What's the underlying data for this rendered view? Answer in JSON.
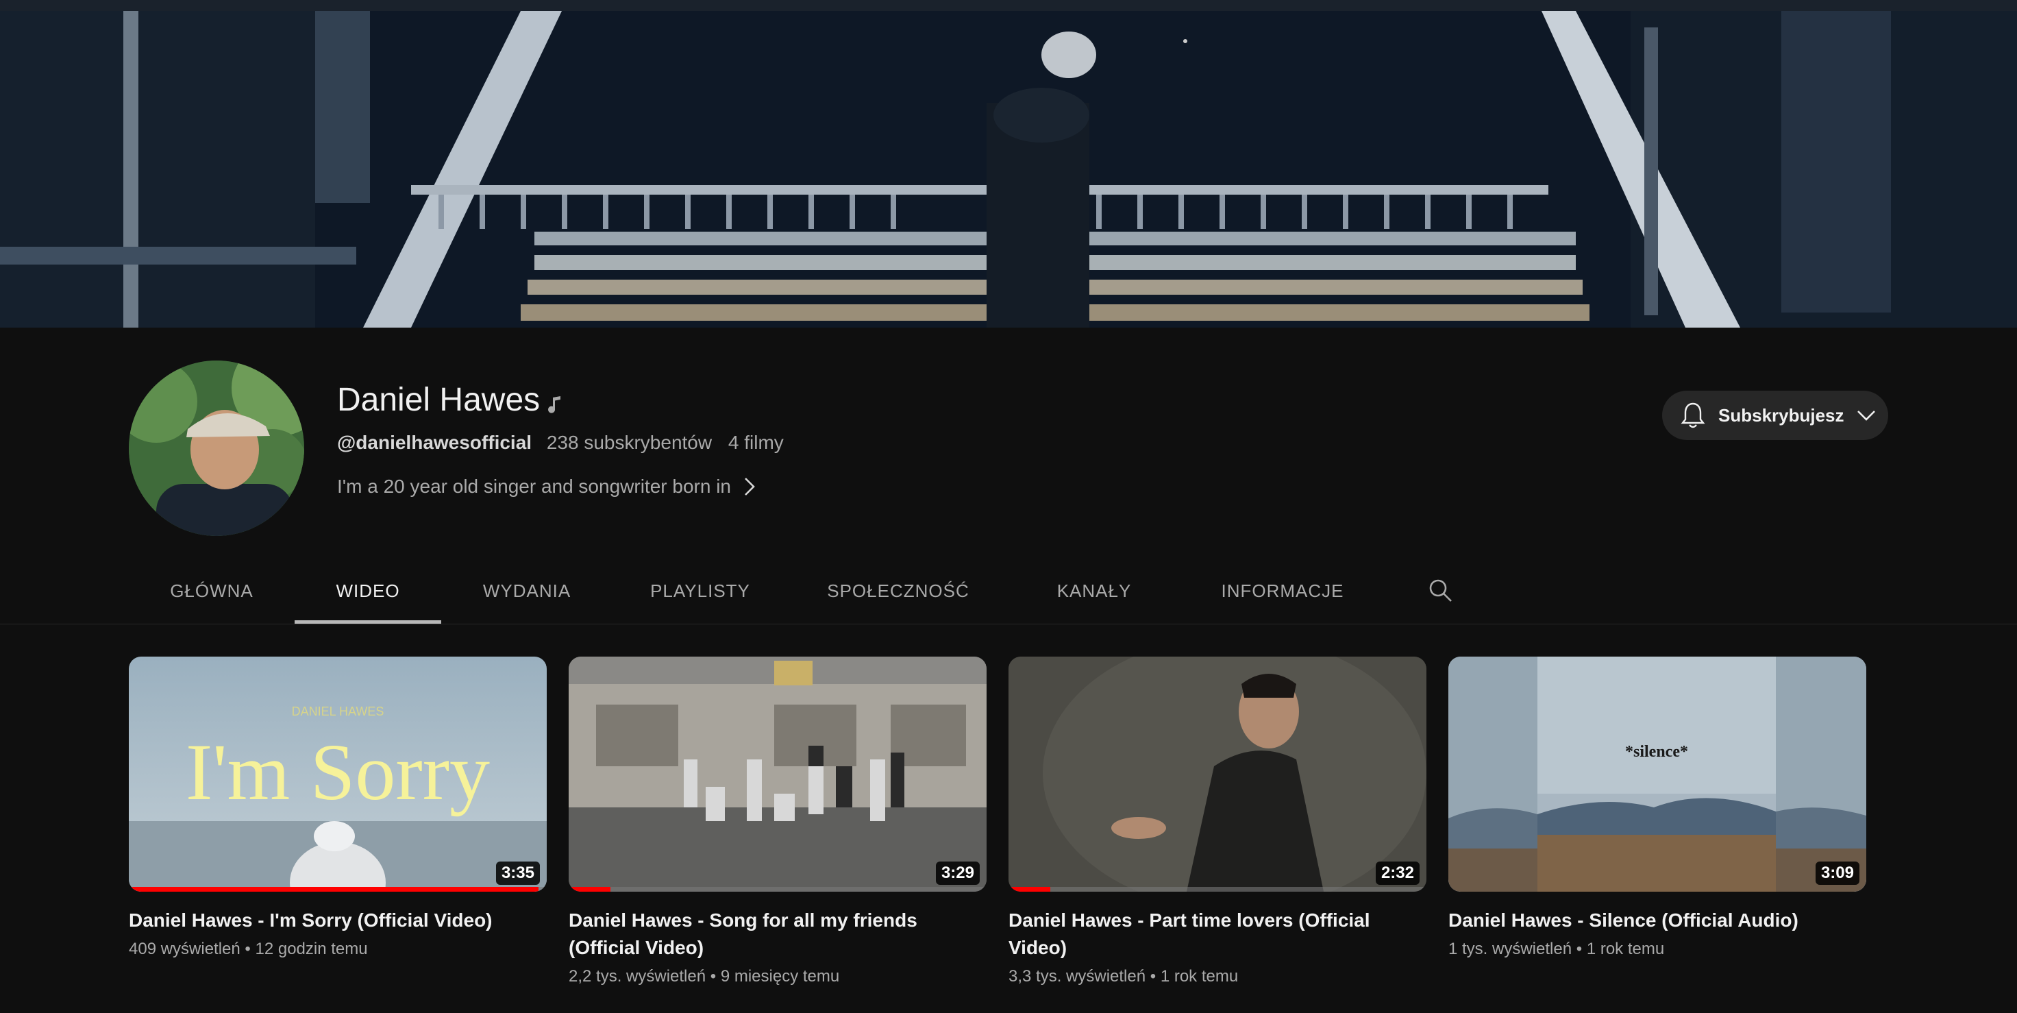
{
  "channel": {
    "name": "Daniel Hawes",
    "handle": "@danielhawesofficial",
    "subscribers": "238 subskrybentów",
    "videos_count": "4 filmy",
    "description": "I'm a 20 year old singer and songwriter born in",
    "subscribe_label": "Subskrybujesz",
    "icons": [
      "music-note-icon",
      "bell-icon",
      "chevron-down-icon",
      "chevron-right-icon"
    ]
  },
  "tabs": [
    {
      "label": "GŁÓWNA",
      "active": false
    },
    {
      "label": "WIDEO",
      "active": true
    },
    {
      "label": "WYDANIA",
      "active": false
    },
    {
      "label": "PLAYLISTY",
      "active": false
    },
    {
      "label": "SPOŁECZNOŚĆ",
      "active": false
    },
    {
      "label": "KANAŁY",
      "active": false
    },
    {
      "label": "INFORMACJE",
      "active": false
    }
  ],
  "videos": [
    {
      "title": "Daniel Hawes - I'm Sorry (Official Video)",
      "views": "409 wyświetleń",
      "age": "12 godzin temu",
      "duration": "3:35",
      "watched_fraction": 0.98,
      "thumb_text": "I'm Sorry",
      "thumb_subtext": "DANIEL HAWES"
    },
    {
      "title": "Daniel Hawes - Song for all my friends (Official Video)",
      "views": "2,2 tys. wyświetleń",
      "age": "9 miesięcy temu",
      "duration": "3:29",
      "watched_fraction": 0.1
    },
    {
      "title": "Daniel Hawes - Part time lovers (Official Video)",
      "views": "3,3 tys. wyświetleń",
      "age": "1 rok temu",
      "duration": "2:32",
      "watched_fraction": 0.1
    },
    {
      "title": "Daniel Hawes - Silence (Official Audio)",
      "views": "1 tys. wyświetleń",
      "age": "1 rok temu",
      "duration": "3:09",
      "watched_fraction": 0,
      "thumb_text": "*silence*"
    }
  ],
  "colors": {
    "background": "#0f0f0f",
    "progress": "#ff0000",
    "button": "#272727"
  }
}
